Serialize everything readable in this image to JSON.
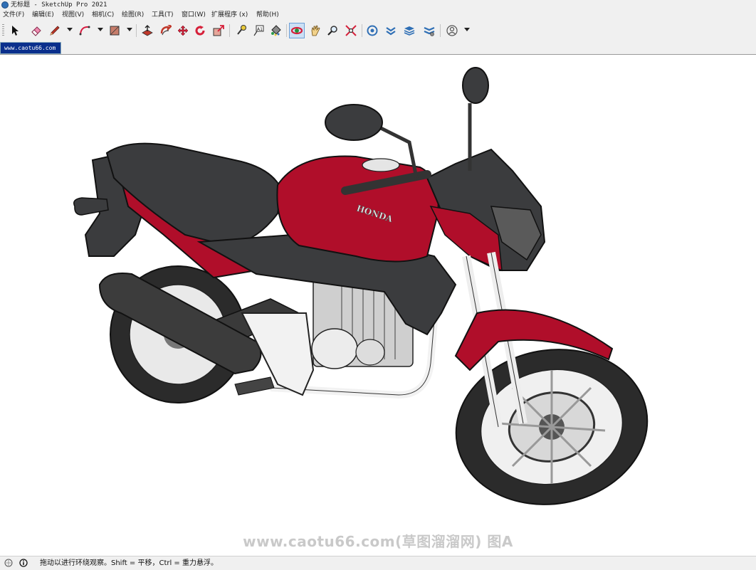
{
  "window": {
    "title": "无标题 - SketchUp Pro 2021"
  },
  "menu": [
    {
      "label": "文件(F)"
    },
    {
      "label": "编辑(E)"
    },
    {
      "label": "视图(V)"
    },
    {
      "label": "相机(C)"
    },
    {
      "label": "绘图(R)"
    },
    {
      "label": "工具(T)"
    },
    {
      "label": "窗口(W)"
    },
    {
      "label": "扩展程序 (x)"
    },
    {
      "label": "帮助(H)"
    }
  ],
  "toolbar": {
    "tools": [
      "select-tool",
      "eraser-tool",
      "line-tool",
      "arc-tool",
      "rectangle-tool",
      "push-pull-tool",
      "follow-me-tool",
      "move-tool",
      "rotate-tool",
      "scale-tool",
      "tape-measure-tool",
      "text-tool",
      "paint-bucket-tool",
      "orbit-tool",
      "pan-tool",
      "zoom-tool",
      "zoom-extents-tool",
      "3d-warehouse",
      "extension-warehouse",
      "layout",
      "extension-manager",
      "account"
    ],
    "active_tool": "orbit-tool",
    "text_tool_glyph": "A1"
  },
  "scene_tab": {
    "label": "www.caotu66.com"
  },
  "model": {
    "description": "Honda CB300 motorcycle 3D model",
    "brand_text": "HONDA",
    "colors": {
      "body": "#b00e2a",
      "seat": "#3b3c3e",
      "frame": "#f2f2f2",
      "tire": "#2b2b2b"
    }
  },
  "watermark": {
    "text": "www.caotu66.com(草图溜溜网) 图A"
  },
  "status": {
    "text": "拖动以进行环绕观察。Shift = 平移，Ctrl = 重力悬浮。"
  }
}
